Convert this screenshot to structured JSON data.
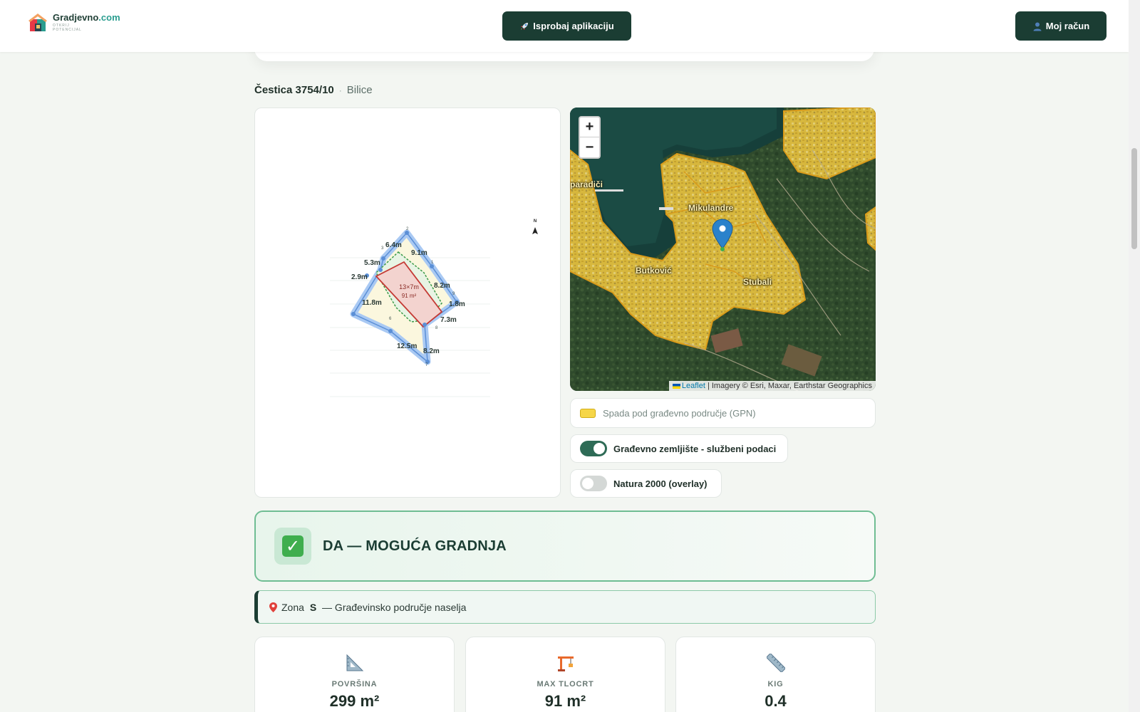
{
  "header": {
    "logo_name": "Gradjevno",
    "logo_tld": ".com",
    "logo_tagline": "OTKRIJ POTENCIJAL",
    "try_app_label": "Isprobaj aplikaciju",
    "account_label": "Moj račun"
  },
  "parcel": {
    "id": "Čestica 3754/10",
    "separator": "·",
    "place": "Bilice"
  },
  "sketch": {
    "north_label": "N",
    "building_dims": "13×7m",
    "building_area": "91 m²",
    "edges": [
      "6.4m",
      "9.1m",
      "5.3m",
      "8.2m",
      "2.9m",
      "1.8m",
      "11.8m",
      "7.3m",
      "12.5m",
      "8.2m"
    ],
    "vertices": [
      "1",
      "2",
      "3",
      "4",
      "5",
      "6",
      "7",
      "8",
      "9"
    ]
  },
  "map": {
    "zoom_in": "+",
    "zoom_out": "−",
    "labels": [
      "paradiči",
      "Mikulandre",
      "Butković",
      "Stubali"
    ],
    "attribution_link": "Leaflet",
    "attribution_text": "| Imagery © Esri, Maxar, Earthstar Geographics"
  },
  "legend": {
    "gpn_label": "Spada pod građevno područje (GPN)",
    "gpn_color": "#f6d648"
  },
  "toggles": {
    "official_label": "Građevno zemljište - službeni podaci",
    "official_on": true,
    "natura_label": "Natura 2000 (overlay)",
    "natura_on": false
  },
  "verdict": {
    "text": "DA — MOGUĆA GRADNJA",
    "color": "#3fae4e"
  },
  "zone": {
    "prefix": "Zona",
    "code": "S",
    "description": "— Građevinsko područje naselja"
  },
  "stats": [
    {
      "icon": "triangle-ruler-icon",
      "label": "POVRŠINA",
      "value": "299 m²"
    },
    {
      "icon": "crane-icon",
      "label": "MAX TLOCRT",
      "value": "91 m²"
    },
    {
      "icon": "ruler-icon",
      "label": "KIG",
      "value": "0.4"
    }
  ],
  "colors": {
    "brand_dark": "#1b3d33",
    "accent_teal": "#2a9d8f"
  }
}
